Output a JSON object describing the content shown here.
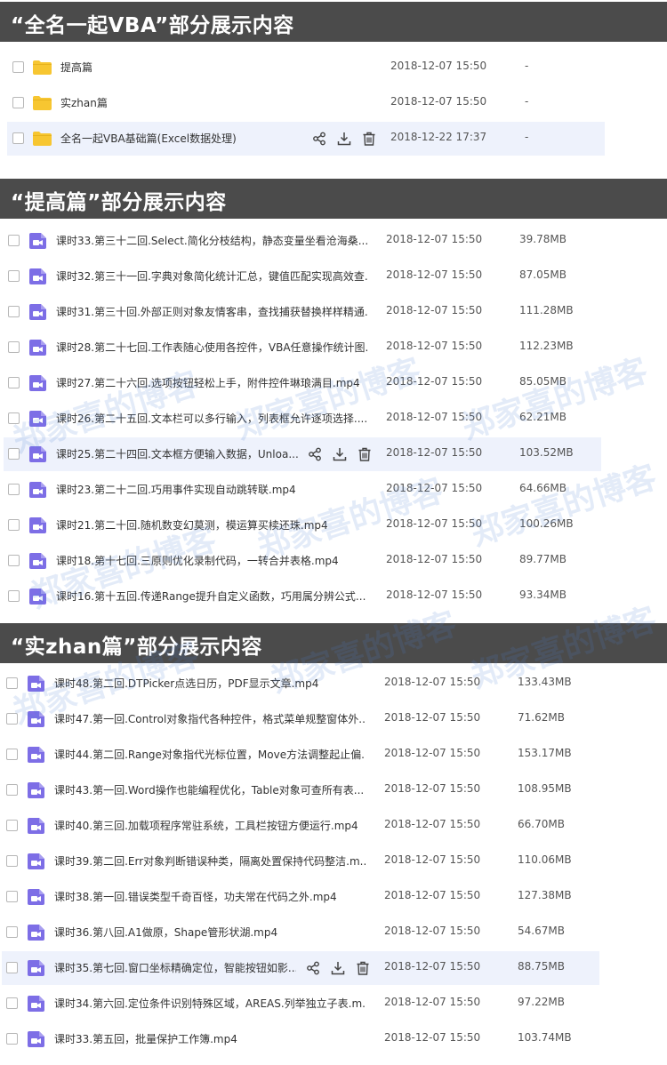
{
  "sections": {
    "s1": {
      "title": "“全名一起VBA”部分展示内容",
      "items": [
        {
          "name": "提高篇",
          "date": "2018-12-07 15:50",
          "size": "-"
        },
        {
          "name": "实zhan篇",
          "date": "2018-12-07 15:50",
          "size": "-"
        },
        {
          "name": "全名一起VBA基础篇(Excel数据处理)",
          "date": "2018-12-22 17:37",
          "size": "-"
        }
      ]
    },
    "s2": {
      "title": "“提高篇”部分展示内容",
      "items": [
        {
          "name": "课时33.第三十二回.Select.简化分枝结构，静态变量坐看沧海桑...",
          "date": "2018-12-07 15:50",
          "size": "39.78MB"
        },
        {
          "name": "课时32.第三十一回.字典对象简化统计汇总，键值匹配实现高效查...",
          "date": "2018-12-07 15:50",
          "size": "87.05MB"
        },
        {
          "name": "课时31.第三十回.外部正则对象友情客串，查找捕获替换样样精通...",
          "date": "2018-12-07 15:50",
          "size": "111.28MB"
        },
        {
          "name": "课时28.第二十七回.工作表随心使用各控件，VBA任意操作统计图...",
          "date": "2018-12-07 15:50",
          "size": "112.23MB"
        },
        {
          "name": "课时27.第二十六回.选项按钮轻松上手，附件控件琳琅满目.mp4",
          "date": "2018-12-07 15:50",
          "size": "85.05MB"
        },
        {
          "name": "课时26.第二十五回.文本栏可以多行输入，列表框允许逐项选择....",
          "date": "2018-12-07 15:50",
          "size": "62.21MB"
        },
        {
          "name": "课时25.第二十四回.文本框方便输入数据，Unloa...",
          "date": "2018-12-07 15:50",
          "size": "103.52MB"
        },
        {
          "name": "课时23.第二十二回.巧用事件实现自动跳转联.mp4",
          "date": "2018-12-07 15:50",
          "size": "64.66MB"
        },
        {
          "name": "课时21.第二十回.随机数变幻莫测，模运算买椟还珠.mp4",
          "date": "2018-12-07 15:50",
          "size": "100.26MB"
        },
        {
          "name": "课时18.第十七回.三原则优化录制代码，一转合并表格.mp4",
          "date": "2018-12-07 15:50",
          "size": "89.77MB"
        },
        {
          "name": "课时16.第十五回.传递Range提升自定义函数，巧用属分辨公式...",
          "date": "2018-12-07 15:50",
          "size": "93.34MB"
        }
      ]
    },
    "s3": {
      "title": "“实zhan篇”部分展示内容",
      "items": [
        {
          "name": "课时48.第二回.DTPicker点选日历，PDF显示文章.mp4",
          "date": "2018-12-07 15:50",
          "size": "133.43MB"
        },
        {
          "name": "课时47.第一回.Control对象指代各种控件，格式菜单规整窗体外...",
          "date": "2018-12-07 15:50",
          "size": "71.62MB"
        },
        {
          "name": "课时44.第二回.Range对象指代光标位置，Move方法调整起止偏...",
          "date": "2018-12-07 15:50",
          "size": "153.17MB"
        },
        {
          "name": "课时43.第一回.Word操作也能编程优化，Table对象可查所有表...",
          "date": "2018-12-07 15:50",
          "size": "108.95MB"
        },
        {
          "name": "课时40.第三回.加载项程序常驻系统，工具栏按钮方便运行.mp4",
          "date": "2018-12-07 15:50",
          "size": "66.70MB"
        },
        {
          "name": "课时39.第二回.Err对象判断错误种类，隔离处置保持代码整洁.m...",
          "date": "2018-12-07 15:50",
          "size": "110.06MB"
        },
        {
          "name": "课时38.第一回.错误类型千奇百怪，功夫常在代码之外.mp4",
          "date": "2018-12-07 15:50",
          "size": "127.38MB"
        },
        {
          "name": "课时36.第八回.A1做原，Shape管形状湖.mp4",
          "date": "2018-12-07 15:50",
          "size": "54.67MB"
        },
        {
          "name": "课时35.第七回.窗口坐标精确定位，智能按钮如影...",
          "date": "2018-12-07 15:50",
          "size": "88.75MB"
        },
        {
          "name": "课时34.第六回.定位条件识别特殊区域，AREAS.列举独立子表.m...",
          "date": "2018-12-07 15:50",
          "size": "97.22MB"
        },
        {
          "name": "课时33.第五回，批量保护工作簿.mp4",
          "date": "2018-12-07 15:50",
          "size": "103.74MB"
        }
      ]
    }
  },
  "watermark": "郑家喜的博客",
  "icons": {
    "folder": "folder-icon",
    "video": "video-file-icon",
    "share": "share-icon",
    "download": "download-icon",
    "delete": "trash-icon"
  },
  "colors": {
    "banner": "#4b4b4b",
    "folder": "#f7c631",
    "video": "#7d6ee6",
    "highlight": "#eef2fc"
  }
}
